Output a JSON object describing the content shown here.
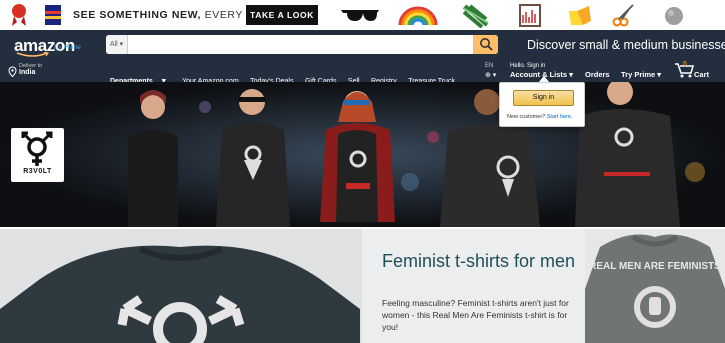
{
  "promo": {
    "text_main": "SEE SOMETHING NEW,",
    "text_em": "EVERY DAY.",
    "button": "TAKE A LOOK",
    "icons": [
      "ribbon-icon",
      "book-icon",
      "sunglasses-icon",
      "rainbow-icon",
      "plant-icon",
      "frame-icon",
      "bag-icon",
      "scissors-icon",
      "ball-icon"
    ]
  },
  "nav": {
    "logo": "amazon",
    "logo_prime": "Try Prime",
    "search_dept": "All",
    "search_placeholder": "",
    "discover": "Discover small & medium businesses",
    "deliver_label": "Deliver to",
    "deliver_country": "India",
    "departments": "Departments",
    "links": [
      "Your Amazon.com",
      "Today's Deals",
      "Gift Cards",
      "Sell",
      "Registry",
      "Treasure Truck"
    ],
    "lang": "EN",
    "hello": "Hello. Sign in",
    "account": "Account & Lists",
    "orders": "Orders",
    "try_prime": "Try Prime",
    "cart_count": "0",
    "cart": "Cart"
  },
  "flyout": {
    "signin": "Sign in",
    "new_customer": "New customer?",
    "start_here": "Start here."
  },
  "hero": {
    "badge_text": "R3V0LT",
    "shirt_texts": [
      "EVOLUTION LOVE IS LOVE",
      "#METOO",
      "REAL MEN ARE FEMINISTS",
      "EVOLVE"
    ]
  },
  "lower": {
    "title": "Feminist t-shirts for men",
    "description": "Feeling masculine? Feminist t-shirts aren't just for women - this Real Men Are Feminists t-shirt is for you!",
    "shirt_text": "REAL MEN ARE FEMINISTS"
  },
  "colors": {
    "nav_bg": "#232f3e",
    "search_button": "#febd69",
    "signin_button": "#f0c14b",
    "title_color": "#1f4e5a",
    "cart_count": "#f08804"
  }
}
